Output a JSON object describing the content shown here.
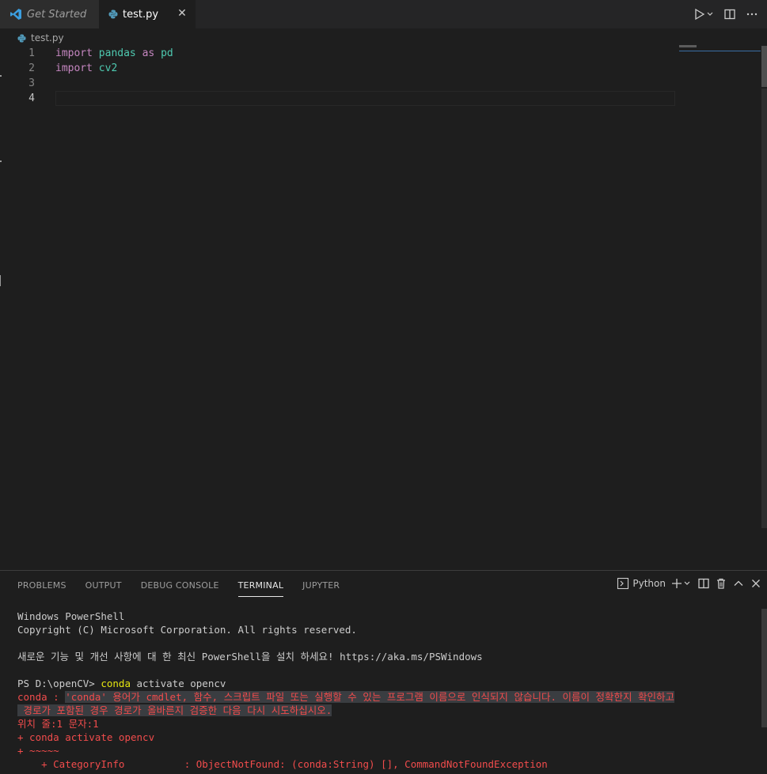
{
  "tabs": [
    {
      "label": "Get Started",
      "icon": "vscode-logo-icon"
    },
    {
      "label": "test.py",
      "icon": "python-file-icon",
      "close": "✕"
    }
  ],
  "breadcrumb": {
    "file": "test.py"
  },
  "editor": {
    "lines": [
      {
        "n": "1",
        "tokens": [
          [
            "import",
            "kw"
          ],
          [
            " ",
            ""
          ],
          [
            "pandas",
            "mod"
          ],
          [
            " ",
            ""
          ],
          [
            "as",
            "kw"
          ],
          [
            " ",
            ""
          ],
          [
            "pd",
            "mod"
          ]
        ]
      },
      {
        "n": "2",
        "tokens": [
          [
            "import",
            "kw"
          ],
          [
            " ",
            ""
          ],
          [
            "cv2",
            "mod"
          ]
        ]
      },
      {
        "n": "3",
        "tokens": []
      },
      {
        "n": "4",
        "tokens": []
      }
    ],
    "current_line": 4
  },
  "panel": {
    "tabs": [
      "PROBLEMS",
      "OUTPUT",
      "DEBUG CONSOLE",
      "TERMINAL",
      "JUPYTER"
    ],
    "active_tab": "TERMINAL",
    "terminal_name": "Python"
  },
  "terminal": {
    "l1": "Windows PowerShell",
    "l2": "Copyright (C) Microsoft Corporation. All rights reserved.",
    "l3": "",
    "l4": "새로운 기능 및 개선 사항에 대 한 최신 PowerShell을 설치 하세요! https://aka.ms/PSWindows",
    "l5": "",
    "prompt": "PS D:\\openCV> ",
    "cmd": "conda",
    "cmd_args": " activate opencv",
    "err_prefix": "conda : ",
    "err_text1": "'conda' 용어가 cmdlet, 함수, 스크립트 파일 또는 실행할 수 있는 프로그램 이름으로 인식되지 않습니다. 이름이 정확한지 확인하고",
    "err_text2": " 경로가 포함된 경우 경로가 올바른지 검증한 다음 다시 시도하십시오.",
    "err_l3": "위치 줄:1 문자:1",
    "err_l4": "+ conda activate opencv",
    "err_l5": "+ ~~~~~",
    "err_l6": "    + CategoryInfo          : ObjectNotFound: (conda:String) [], CommandNotFoundException"
  },
  "colors": {
    "accent": "#007acc",
    "error": "#f14c4c",
    "keyword": "#c586c0",
    "module": "#4ec9b0"
  }
}
